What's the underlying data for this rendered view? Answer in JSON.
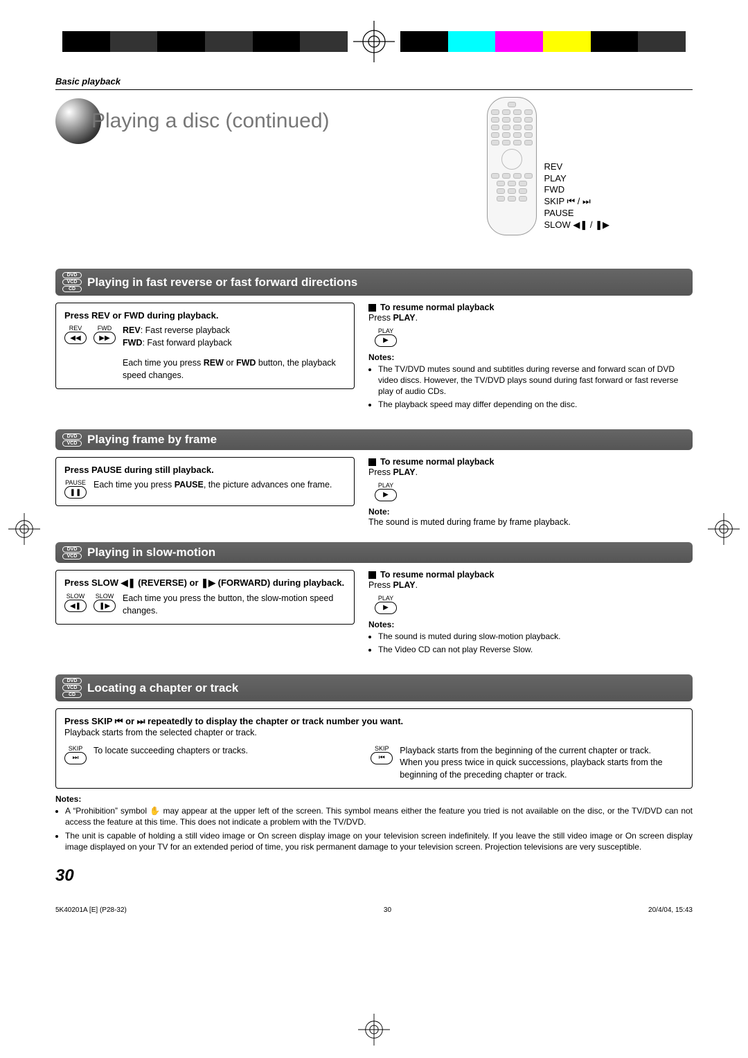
{
  "header": {
    "category": "Basic playback"
  },
  "title": "Playing a disc (continued)",
  "remote_labels": [
    "REV",
    "PLAY",
    "FWD",
    "SKIP ⏮ / ⏭",
    "PAUSE",
    "SLOW ◀❚ / ❚▶"
  ],
  "section1": {
    "title": "Playing in fast reverse or fast forward directions",
    "discs": [
      "DVD",
      "VCD",
      "CD"
    ],
    "box_heading": "Press REV or FWD during playback.",
    "btn_labels": {
      "rev": "REV",
      "fwd": "FWD"
    },
    "line1a": "REV",
    "line1b": ":  Fast reverse playback",
    "line2a": "FWD",
    "line2b": ": Fast forward playback",
    "para_a": "Each time you press ",
    "para_b": "REW",
    "para_c": " or ",
    "para_d": "FWD",
    "para_e": " button, the playback speed changes.",
    "resume_heading": "To resume normal playback",
    "resume_text_a": "Press ",
    "resume_text_b": "PLAY",
    "resume_text_c": ".",
    "play_label": "PLAY",
    "notes_label": "Notes:",
    "notes": [
      "The TV/DVD mutes sound and subtitles during reverse and forward scan of DVD video discs. However, the TV/DVD plays sound during fast forward or fast reverse play of audio CDs.",
      "The playback speed may differ depending on the disc."
    ]
  },
  "section2": {
    "title": "Playing frame by frame",
    "discs": [
      "DVD",
      "VCD"
    ],
    "box_heading": "Press PAUSE during still playback.",
    "btn_label": "PAUSE",
    "para_a": "Each time you press ",
    "para_b": "PAUSE",
    "para_c": ", the picture advances one frame.",
    "resume_heading": "To resume normal playback",
    "resume_text_a": "Press ",
    "resume_text_b": "PLAY",
    "resume_text_c": ".",
    "play_label": "PLAY",
    "note_label": "Note:",
    "note": "The sound is muted during frame by frame playback."
  },
  "section3": {
    "title": "Playing in slow-motion",
    "discs": [
      "DVD",
      "VCD"
    ],
    "box_heading_a": "Press SLOW ",
    "box_heading_b": " (REVERSE) or ",
    "box_heading_c": " (FORWARD) during playback.",
    "btn_labels": {
      "slow1": "SLOW",
      "slow2": "SLOW"
    },
    "para": "Each time you press the button, the slow-motion speed changes.",
    "resume_heading": "To resume normal playback",
    "resume_text_a": "Press ",
    "resume_text_b": "PLAY",
    "resume_text_c": ".",
    "play_label": "PLAY",
    "notes_label": "Notes:",
    "notes": [
      "The sound is muted during slow-motion playback.",
      "The Video CD can not play Reverse Slow."
    ]
  },
  "section4": {
    "title": "Locating a chapter or track",
    "discs": [
      "DVD",
      "VCD",
      "CD"
    ],
    "box_heading_a": "Press SKIP ",
    "box_heading_b": " or ",
    "box_heading_c": " repeatedly to display the chapter or track number you want.",
    "sub": "Playback starts from the selected chapter or track.",
    "btn_labels": {
      "next": "SKIP",
      "prev": "SKIP"
    },
    "col1": "To locate succeeding chapters or tracks.",
    "col2": "Playback starts from the beginning of the current chapter or track.\nWhen you press twice in quick successions, playback starts from the beginning of the preceding chapter or track."
  },
  "bottom_notes_label": "Notes:",
  "bottom_notes": [
    "A “Prohibition” symbol ✋ may appear at the upper left of the screen. This symbol means either the feature you tried is not available on the disc, or the TV/DVD can not access the feature at this time. This does not indicate a problem with the TV/DVD.",
    "The unit is capable of holding a still video image or On screen display image on your television screen indefinitely. If you leave the still video image or On screen display image displayed on your TV for an extended period of time, you risk permanent damage to your television screen.  Projection televisions are very susceptible."
  ],
  "page_number": "30",
  "footer": {
    "left": "5K40201A [E] (P28-32)",
    "center": "30",
    "right": "20/4/04, 15:43"
  }
}
